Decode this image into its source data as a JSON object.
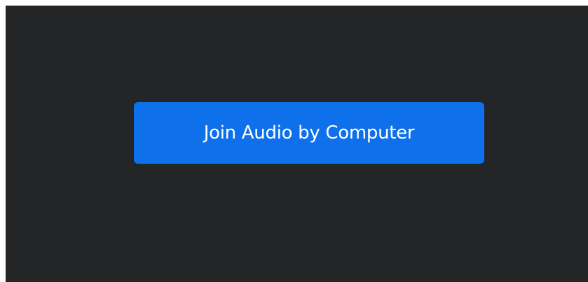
{
  "dialog": {
    "join_audio_button_label": "Join Audio by Computer"
  },
  "colors": {
    "background": "#242527",
    "button": "#0E71EB",
    "button_text": "#FFFFFF"
  }
}
